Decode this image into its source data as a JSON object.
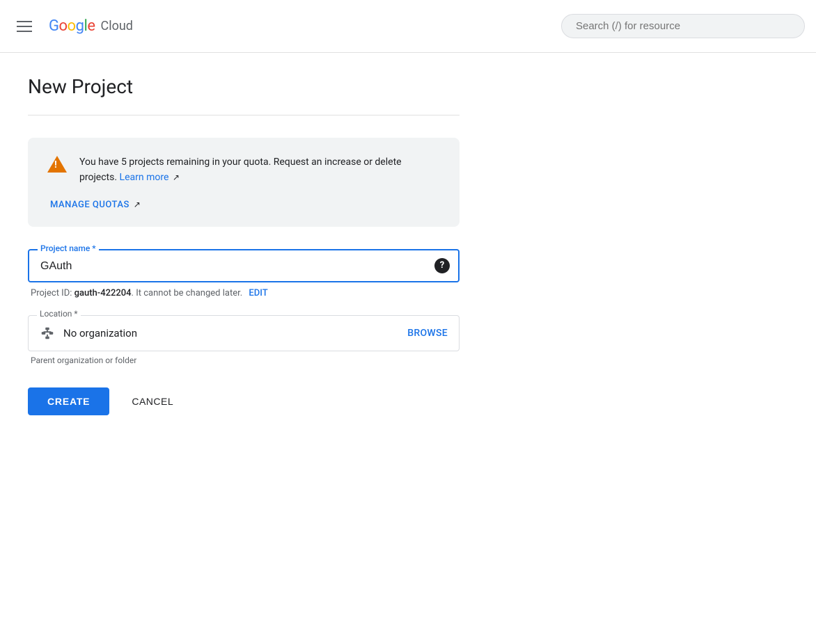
{
  "header": {
    "menu_label": "Main menu",
    "logo": {
      "google": "Google",
      "cloud": "Cloud"
    },
    "search_placeholder": "Search (/) for resource"
  },
  "page": {
    "title": "New Project"
  },
  "alert": {
    "message": "You have 5 projects remaining in your quota. Request an increase or delete projects.",
    "learn_more_label": "Learn more",
    "manage_quotas_label": "MANAGE QUOTAS"
  },
  "form": {
    "project_name_label": "Project name *",
    "project_name_value": "GAuth",
    "project_id_prefix": "Project ID: ",
    "project_id": "gauth-422204",
    "project_id_suffix": ". It cannot be changed later.",
    "edit_label": "EDIT",
    "location_label": "Location *",
    "location_value": "No organization",
    "browse_label": "BROWSE",
    "parent_hint": "Parent organization or folder"
  },
  "buttons": {
    "create_label": "CREATE",
    "cancel_label": "CANCEL"
  }
}
